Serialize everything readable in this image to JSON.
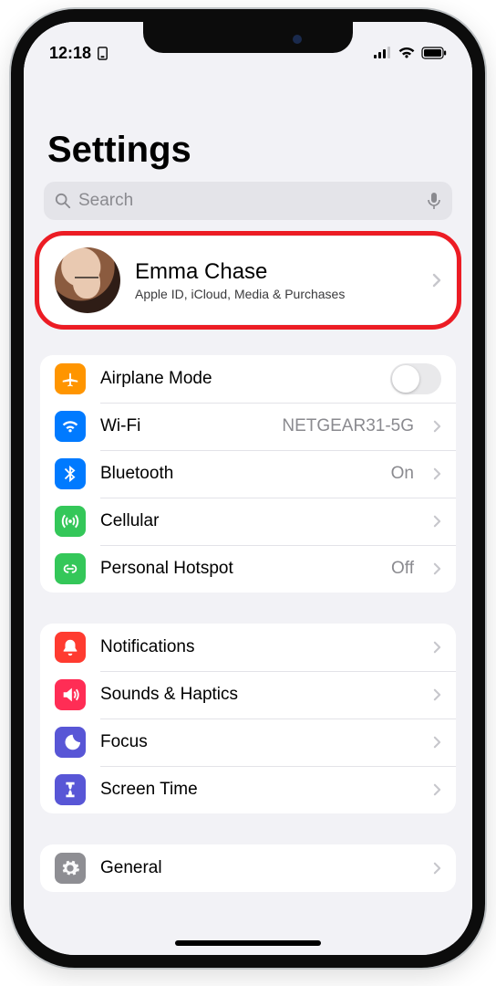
{
  "status": {
    "time": "12:18"
  },
  "title": "Settings",
  "search": {
    "placeholder": "Search"
  },
  "profile": {
    "name": "Emma Chase",
    "subtitle": "Apple ID, iCloud, Media & Purchases"
  },
  "groups": [
    {
      "rows": [
        {
          "icon": "airplane",
          "icon_color": "#ff9500",
          "label": "Airplane Mode",
          "value": "",
          "accessory": "toggle",
          "toggle_on": false
        },
        {
          "icon": "wifi",
          "icon_color": "#007aff",
          "label": "Wi-Fi",
          "value": "NETGEAR31-5G",
          "accessory": "chevron"
        },
        {
          "icon": "bluetooth",
          "icon_color": "#007aff",
          "label": "Bluetooth",
          "value": "On",
          "accessory": "chevron"
        },
        {
          "icon": "cellular",
          "icon_color": "#34c759",
          "label": "Cellular",
          "value": "",
          "accessory": "chevron"
        },
        {
          "icon": "hotspot",
          "icon_color": "#34c759",
          "label": "Personal Hotspot",
          "value": "Off",
          "accessory": "chevron"
        }
      ]
    },
    {
      "rows": [
        {
          "icon": "notifications",
          "icon_color": "#ff3b30",
          "label": "Notifications",
          "value": "",
          "accessory": "chevron"
        },
        {
          "icon": "sounds",
          "icon_color": "#ff2d55",
          "label": "Sounds & Haptics",
          "value": "",
          "accessory": "chevron"
        },
        {
          "icon": "focus",
          "icon_color": "#5856d6",
          "label": "Focus",
          "value": "",
          "accessory": "chevron"
        },
        {
          "icon": "screentime",
          "icon_color": "#5856d6",
          "label": "Screen Time",
          "value": "",
          "accessory": "chevron"
        }
      ]
    },
    {
      "rows": [
        {
          "icon": "general",
          "icon_color": "#8e8e93",
          "label": "General",
          "value": "",
          "accessory": "chevron"
        }
      ]
    }
  ]
}
